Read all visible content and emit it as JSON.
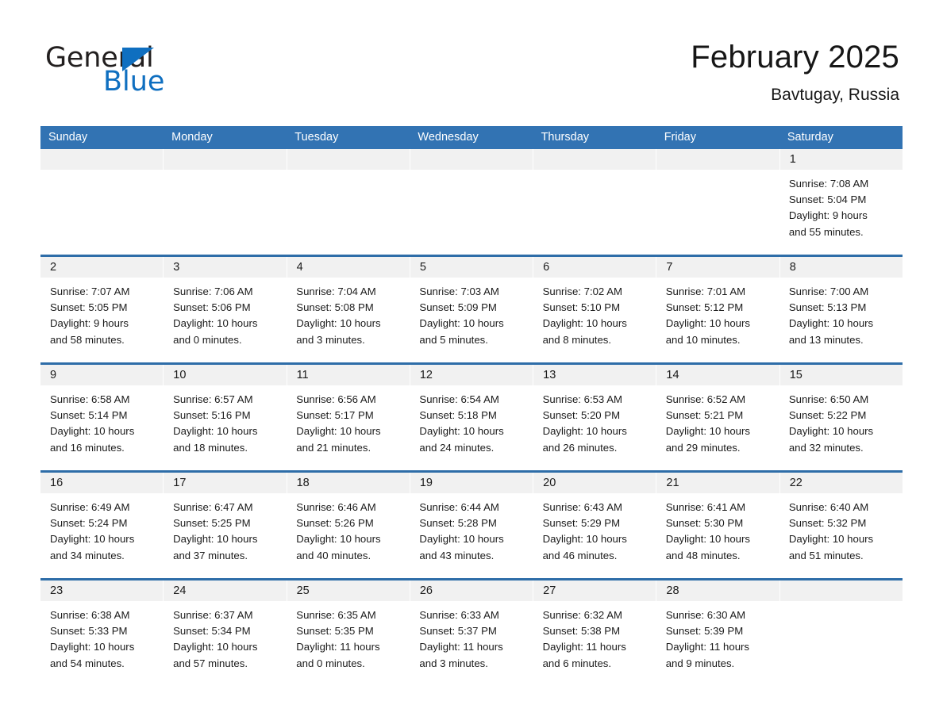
{
  "brand": {
    "name_part1": "General",
    "name_part2": "Blue",
    "triangle_color": "#0f6fc0"
  },
  "header": {
    "title": "February 2025",
    "location": "Bavtugay, Russia"
  },
  "colors": {
    "header_blue": "#3273b3",
    "week_divider_blue": "#2e6da8",
    "daynum_band": "#f1f1f1",
    "text": "#1b1b1b"
  },
  "calendar": {
    "weekdays": [
      "Sunday",
      "Monday",
      "Tuesday",
      "Wednesday",
      "Thursday",
      "Friday",
      "Saturday"
    ],
    "weeks": [
      {
        "days": [
          {
            "num": "",
            "lines": []
          },
          {
            "num": "",
            "lines": []
          },
          {
            "num": "",
            "lines": []
          },
          {
            "num": "",
            "lines": []
          },
          {
            "num": "",
            "lines": []
          },
          {
            "num": "",
            "lines": []
          },
          {
            "num": "1",
            "lines": [
              "Sunrise: 7:08 AM",
              "Sunset: 5:04 PM",
              "Daylight: 9 hours",
              "and 55 minutes."
            ]
          }
        ]
      },
      {
        "days": [
          {
            "num": "2",
            "lines": [
              "Sunrise: 7:07 AM",
              "Sunset: 5:05 PM",
              "Daylight: 9 hours",
              "and 58 minutes."
            ]
          },
          {
            "num": "3",
            "lines": [
              "Sunrise: 7:06 AM",
              "Sunset: 5:06 PM",
              "Daylight: 10 hours",
              "and 0 minutes."
            ]
          },
          {
            "num": "4",
            "lines": [
              "Sunrise: 7:04 AM",
              "Sunset: 5:08 PM",
              "Daylight: 10 hours",
              "and 3 minutes."
            ]
          },
          {
            "num": "5",
            "lines": [
              "Sunrise: 7:03 AM",
              "Sunset: 5:09 PM",
              "Daylight: 10 hours",
              "and 5 minutes."
            ]
          },
          {
            "num": "6",
            "lines": [
              "Sunrise: 7:02 AM",
              "Sunset: 5:10 PM",
              "Daylight: 10 hours",
              "and 8 minutes."
            ]
          },
          {
            "num": "7",
            "lines": [
              "Sunrise: 7:01 AM",
              "Sunset: 5:12 PM",
              "Daylight: 10 hours",
              "and 10 minutes."
            ]
          },
          {
            "num": "8",
            "lines": [
              "Sunrise: 7:00 AM",
              "Sunset: 5:13 PM",
              "Daylight: 10 hours",
              "and 13 minutes."
            ]
          }
        ]
      },
      {
        "days": [
          {
            "num": "9",
            "lines": [
              "Sunrise: 6:58 AM",
              "Sunset: 5:14 PM",
              "Daylight: 10 hours",
              "and 16 minutes."
            ]
          },
          {
            "num": "10",
            "lines": [
              "Sunrise: 6:57 AM",
              "Sunset: 5:16 PM",
              "Daylight: 10 hours",
              "and 18 minutes."
            ]
          },
          {
            "num": "11",
            "lines": [
              "Sunrise: 6:56 AM",
              "Sunset: 5:17 PM",
              "Daylight: 10 hours",
              "and 21 minutes."
            ]
          },
          {
            "num": "12",
            "lines": [
              "Sunrise: 6:54 AM",
              "Sunset: 5:18 PM",
              "Daylight: 10 hours",
              "and 24 minutes."
            ]
          },
          {
            "num": "13",
            "lines": [
              "Sunrise: 6:53 AM",
              "Sunset: 5:20 PM",
              "Daylight: 10 hours",
              "and 26 minutes."
            ]
          },
          {
            "num": "14",
            "lines": [
              "Sunrise: 6:52 AM",
              "Sunset: 5:21 PM",
              "Daylight: 10 hours",
              "and 29 minutes."
            ]
          },
          {
            "num": "15",
            "lines": [
              "Sunrise: 6:50 AM",
              "Sunset: 5:22 PM",
              "Daylight: 10 hours",
              "and 32 minutes."
            ]
          }
        ]
      },
      {
        "days": [
          {
            "num": "16",
            "lines": [
              "Sunrise: 6:49 AM",
              "Sunset: 5:24 PM",
              "Daylight: 10 hours",
              "and 34 minutes."
            ]
          },
          {
            "num": "17",
            "lines": [
              "Sunrise: 6:47 AM",
              "Sunset: 5:25 PM",
              "Daylight: 10 hours",
              "and 37 minutes."
            ]
          },
          {
            "num": "18",
            "lines": [
              "Sunrise: 6:46 AM",
              "Sunset: 5:26 PM",
              "Daylight: 10 hours",
              "and 40 minutes."
            ]
          },
          {
            "num": "19",
            "lines": [
              "Sunrise: 6:44 AM",
              "Sunset: 5:28 PM",
              "Daylight: 10 hours",
              "and 43 minutes."
            ]
          },
          {
            "num": "20",
            "lines": [
              "Sunrise: 6:43 AM",
              "Sunset: 5:29 PM",
              "Daylight: 10 hours",
              "and 46 minutes."
            ]
          },
          {
            "num": "21",
            "lines": [
              "Sunrise: 6:41 AM",
              "Sunset: 5:30 PM",
              "Daylight: 10 hours",
              "and 48 minutes."
            ]
          },
          {
            "num": "22",
            "lines": [
              "Sunrise: 6:40 AM",
              "Sunset: 5:32 PM",
              "Daylight: 10 hours",
              "and 51 minutes."
            ]
          }
        ]
      },
      {
        "days": [
          {
            "num": "23",
            "lines": [
              "Sunrise: 6:38 AM",
              "Sunset: 5:33 PM",
              "Daylight: 10 hours",
              "and 54 minutes."
            ]
          },
          {
            "num": "24",
            "lines": [
              "Sunrise: 6:37 AM",
              "Sunset: 5:34 PM",
              "Daylight: 10 hours",
              "and 57 minutes."
            ]
          },
          {
            "num": "25",
            "lines": [
              "Sunrise: 6:35 AM",
              "Sunset: 5:35 PM",
              "Daylight: 11 hours",
              "and 0 minutes."
            ]
          },
          {
            "num": "26",
            "lines": [
              "Sunrise: 6:33 AM",
              "Sunset: 5:37 PM",
              "Daylight: 11 hours",
              "and 3 minutes."
            ]
          },
          {
            "num": "27",
            "lines": [
              "Sunrise: 6:32 AM",
              "Sunset: 5:38 PM",
              "Daylight: 11 hours",
              "and 6 minutes."
            ]
          },
          {
            "num": "28",
            "lines": [
              "Sunrise: 6:30 AM",
              "Sunset: 5:39 PM",
              "Daylight: 11 hours",
              "and 9 minutes."
            ]
          },
          {
            "num": "",
            "lines": []
          }
        ]
      }
    ]
  }
}
